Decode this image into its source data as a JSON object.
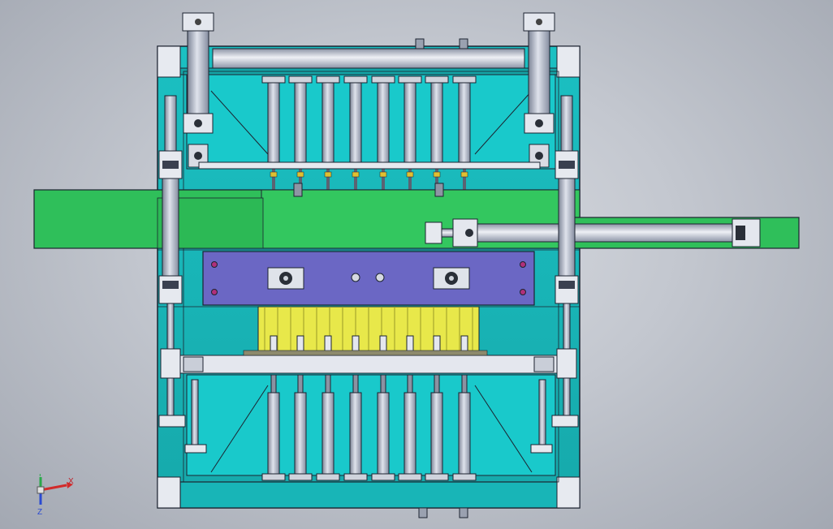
{
  "viewport": {
    "background": "gradient-gray",
    "colors": {
      "frame_teal": "#1fc3c3",
      "frame_dark": "#17a3a3",
      "bar_green": "#2fbf5a",
      "plate_purple": "#6b67c4",
      "comb_yellow": "#e8e84a",
      "steel": "#b7bcc9",
      "edge": "#1c2330"
    }
  },
  "triad": {
    "x_label": "X",
    "y_label": "Y",
    "z_label": "Z",
    "x_color": "#d22a2a",
    "y_color": "#2aa84a",
    "z_color": "#2a4ad2"
  }
}
